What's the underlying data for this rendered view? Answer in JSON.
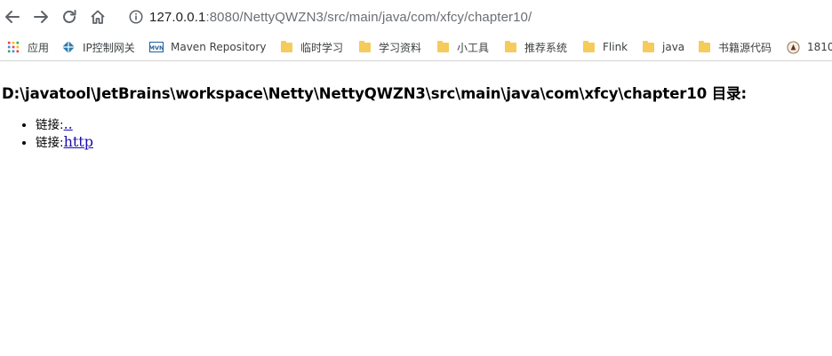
{
  "browser": {
    "url_host": "127.0.0.1",
    "url_rest": ":8080/NettyQWZN3/src/main/java/com/xfcy/chapter10/",
    "nav_icons": [
      "back-arrow-icon",
      "forward-arrow-icon",
      "reload-icon",
      "home-icon"
    ],
    "site_info_icon": "info-circle-icon"
  },
  "bookmarks": [
    {
      "label": "应用",
      "icon": "apps-grid-icon"
    },
    {
      "label": "IP控制网关",
      "icon": "diamond-site-icon"
    },
    {
      "label": "Maven Repository",
      "icon": "mvn-logo-icon"
    },
    {
      "label": "临时学习",
      "icon": "folder-icon"
    },
    {
      "label": "学习资料",
      "icon": "folder-icon"
    },
    {
      "label": "小工具",
      "icon": "folder-icon"
    },
    {
      "label": "推荐系统",
      "icon": "folder-icon"
    },
    {
      "label": "Flink",
      "icon": "folder-icon"
    },
    {
      "label": "java",
      "icon": "folder-icon"
    },
    {
      "label": "书籍源代码",
      "icon": "folder-icon"
    },
    {
      "label": "1810",
      "icon": "university-seal-icon"
    }
  ],
  "page": {
    "title": "D:\\javatool\\JetBrains\\workspace\\Netty\\NettyQWZN3\\src\\main\\java\\com\\xfcy\\chapter10 目录:",
    "links": [
      {
        "prefix": "链接:",
        "text": ".."
      },
      {
        "prefix": "链接:",
        "text": "http"
      }
    ]
  },
  "colors": {
    "link": "#1a0dab",
    "folder": "#f5cb5c",
    "url_host": "#202124",
    "url_rest": "#6b6f73"
  }
}
